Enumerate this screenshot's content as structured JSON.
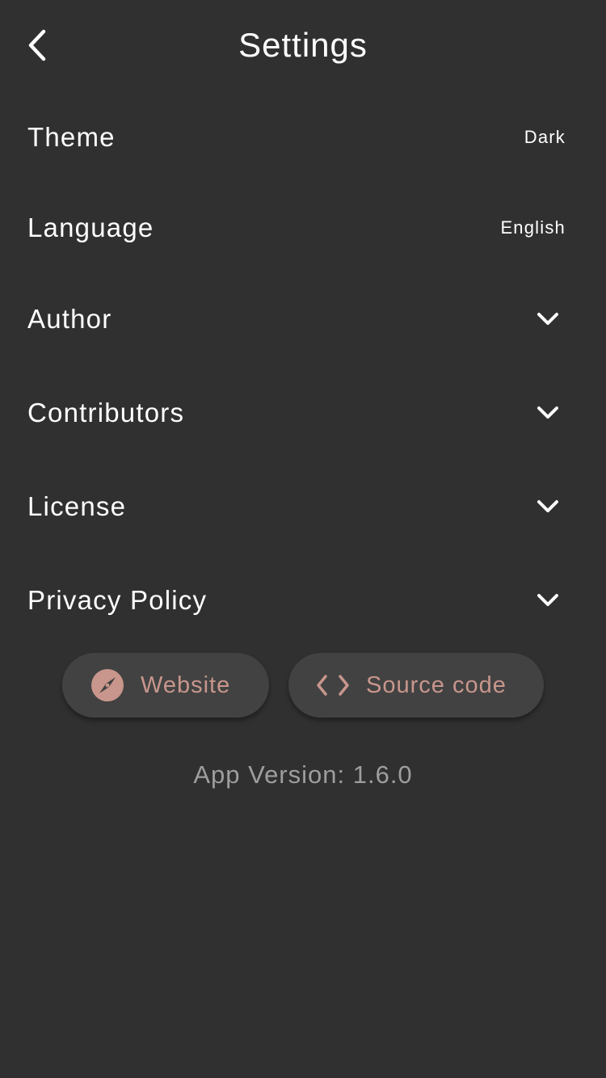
{
  "header": {
    "title": "Settings",
    "back_icon": "chevron-left-icon"
  },
  "settings": {
    "theme": {
      "label": "Theme",
      "value": "Dark"
    },
    "language": {
      "label": "Language",
      "value": "English"
    },
    "author": {
      "label": "Author",
      "icon": "chevron-down-icon"
    },
    "contributors": {
      "label": "Contributors",
      "icon": "chevron-down-icon"
    },
    "license": {
      "label": "License",
      "icon": "chevron-down-icon"
    },
    "privacy": {
      "label": "Privacy Policy",
      "icon": "chevron-down-icon"
    }
  },
  "links": {
    "website": {
      "label": "Website",
      "icon": "compass-icon"
    },
    "source": {
      "label": "Source code",
      "icon": "code-icon"
    }
  },
  "footer": {
    "version": "App Version: 1.6.0"
  },
  "colors": {
    "background": "#303030",
    "button_background": "#424242",
    "accent": "#c8968c",
    "muted_text": "#9e9e9e"
  }
}
